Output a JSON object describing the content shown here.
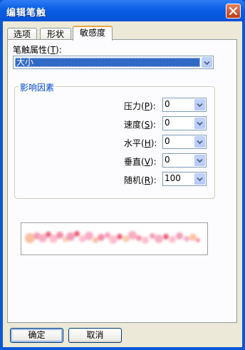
{
  "window": {
    "title": "编辑笔触"
  },
  "tabs": [
    {
      "label": "选项"
    },
    {
      "label": "形状"
    },
    {
      "label": "敏感度",
      "active": true
    }
  ],
  "stroke_property": {
    "label": "笔触属性",
    "mnemonic": "T",
    "value": "大小"
  },
  "influence_group": {
    "title": "影响因素",
    "fields": [
      {
        "label": "压力",
        "mnemonic": "P",
        "value": "0"
      },
      {
        "label": "速度",
        "mnemonic": "S",
        "value": "0"
      },
      {
        "label": "水平",
        "mnemonic": "H",
        "value": "0"
      },
      {
        "label": "垂直",
        "mnemonic": "V",
        "value": "0"
      },
      {
        "label": "随机",
        "mnemonic": "R",
        "value": "100"
      }
    ]
  },
  "preview": {
    "description_colors": [
      "#f7b58e",
      "#f08cab",
      "#e6425f",
      "#ffb3c8"
    ]
  },
  "buttons": {
    "ok": "确定",
    "cancel": "取消"
  },
  "colors": {
    "titlebar": "#0a58d4",
    "tab_highlight": "#e8a640",
    "selected": "#316ac5",
    "group_title": "#0046d5"
  }
}
